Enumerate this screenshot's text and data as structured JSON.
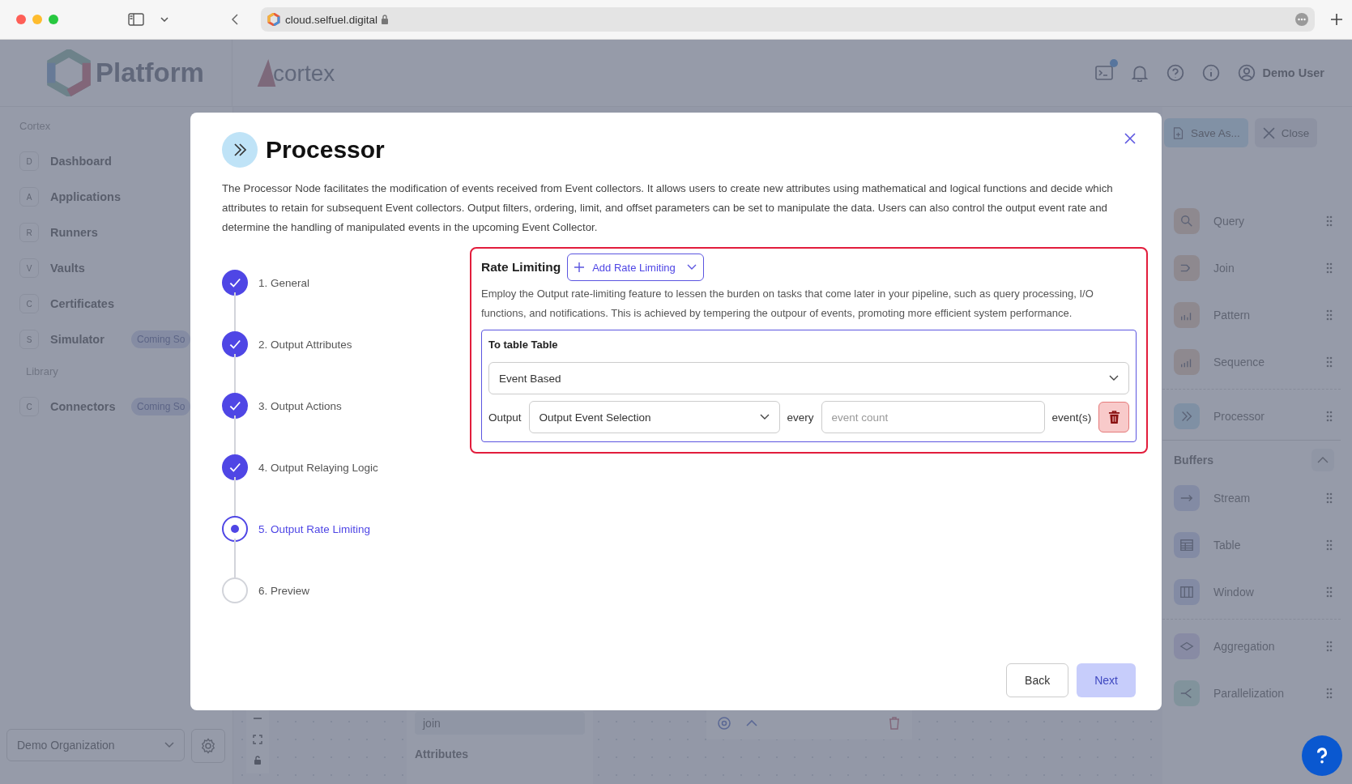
{
  "browser": {
    "url": "cloud.selfuel.digital"
  },
  "header": {
    "brand": "Platform",
    "product": "cortex",
    "user": "Demo User",
    "terminal_badge": true
  },
  "sidebar": {
    "sections": [
      {
        "title": "Cortex",
        "items": [
          {
            "badge": "D",
            "label": "Dashboard"
          },
          {
            "badge": "A",
            "label": "Applications"
          },
          {
            "badge": "R",
            "label": "Runners"
          },
          {
            "badge": "V",
            "label": "Vaults"
          },
          {
            "badge": "C",
            "label": "Certificates"
          },
          {
            "badge": "S",
            "label": "Simulator",
            "tag": "Coming So"
          }
        ]
      },
      {
        "title": "Library",
        "items": [
          {
            "badge": "C",
            "label": "Connectors",
            "tag": "Coming So"
          }
        ]
      }
    ],
    "organization": "Demo Organization"
  },
  "canvas": {
    "node_field": "join",
    "section": "Attributes"
  },
  "palette": {
    "actions": [
      {
        "kind": "save",
        "label": "Save As..."
      },
      {
        "kind": "close",
        "label": "Close"
      }
    ],
    "groups": [
      {
        "items": [
          {
            "kind": "query",
            "label": "Query"
          },
          {
            "kind": "join",
            "label": "Join"
          },
          {
            "kind": "pattern",
            "label": "Pattern"
          },
          {
            "kind": "sequence",
            "label": "Sequence"
          }
        ]
      },
      {
        "items": [
          {
            "kind": "processor",
            "label": "Processor"
          }
        ]
      },
      {
        "title": "Buffers",
        "expanded": true,
        "items": [
          {
            "kind": "stream",
            "label": "Stream"
          },
          {
            "kind": "table",
            "label": "Table"
          },
          {
            "kind": "window",
            "label": "Window"
          }
        ]
      },
      {
        "items": [
          {
            "kind": "aggregation",
            "label": "Aggregation"
          },
          {
            "kind": "parallelization",
            "label": "Parallelization"
          }
        ]
      }
    ]
  },
  "modal": {
    "title": "Processor",
    "description": "The Processor Node facilitates the modification of events received from Event collectors. It allows users to create new attributes using mathematical and logical functions and decide which attributes to retain for subsequent Event collectors. Output filters, ordering, limit, and offset parameters can be set to manipulate the data. Users can also control the output event rate and determine the handling of manipulated events in the upcoming Event Collector.",
    "steps": [
      {
        "label": "1. General",
        "done": true,
        "selected": false
      },
      {
        "label": "2. Output Attributes",
        "done": true,
        "selected": false
      },
      {
        "label": "3. Output Actions",
        "done": true,
        "selected": false
      },
      {
        "label": "4. Output Relaying Logic",
        "done": true,
        "selected": false
      },
      {
        "label": "5. Output Rate Limiting",
        "done": false,
        "selected": true
      },
      {
        "label": "6. Preview",
        "done": false,
        "selected": false
      }
    ],
    "rate_limiting": {
      "title": "Rate Limiting",
      "add_button": "Add Rate Limiting",
      "description": "Employ the Output rate-limiting feature to lessen the burden on tasks that come later in your pipeline, such as query processing, I/O functions, and notifications. This is achieved by tempering the outpour of events, promoting more efficient system performance.",
      "card_title": "To table Table",
      "type": "Event Based",
      "output_label": "Output",
      "output_select": "Output Event Selection",
      "every_label": "every",
      "count_placeholder": "event count",
      "unit": "event(s)"
    },
    "buttons": {
      "back": "Back",
      "next": "Next"
    }
  }
}
